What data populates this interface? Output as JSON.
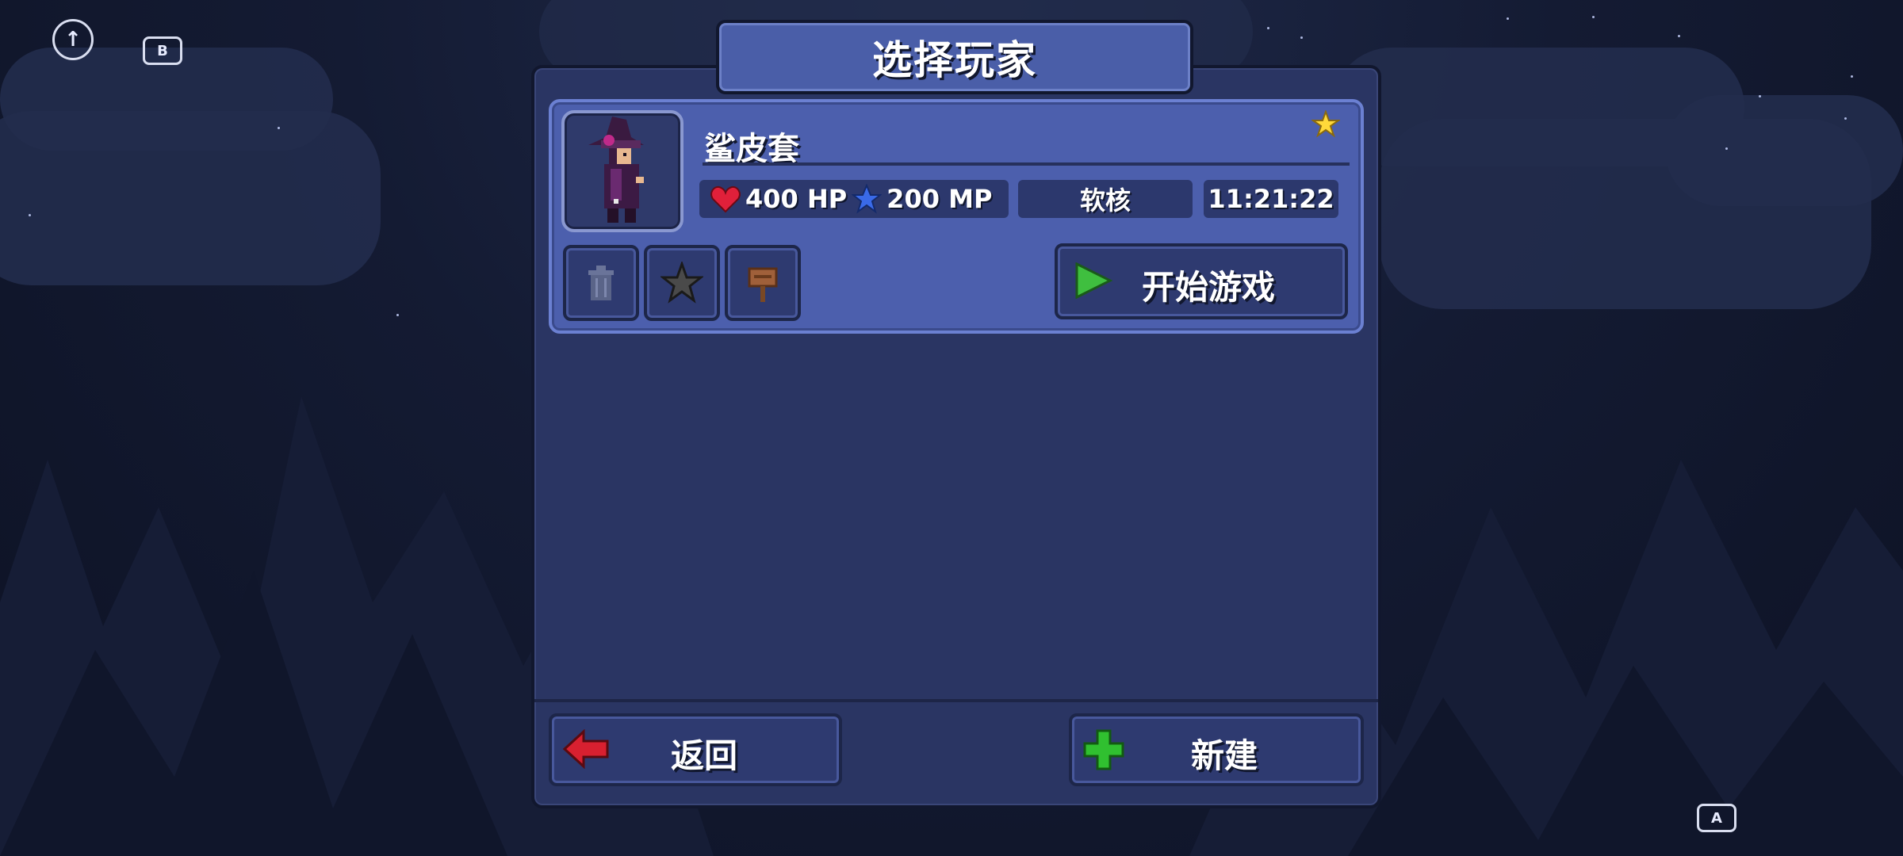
{
  "dialog": {
    "title": "选择玩家"
  },
  "player": {
    "name": "鲨皮套",
    "hp": "400 HP",
    "mp": "200 MP",
    "mode": "软核",
    "playtime": "11:21:22"
  },
  "actions": {
    "play_label": "开始游戏",
    "back_label": "返回",
    "new_label": "新建"
  },
  "corner_buttons": {
    "b": "B",
    "a": "A",
    "up": "↑"
  },
  "icons": {
    "delete": "trash-icon",
    "favorite": "star-icon",
    "rename": "sign-icon",
    "play": "play-arrow-icon",
    "back": "red-arrow-icon",
    "new": "green-plus-icon",
    "heart": "heart-icon",
    "mana": "mana-star-icon"
  },
  "colors": {
    "panel": "#2a3563",
    "title": "#4a5ea8",
    "card": "#4c5fad",
    "heart": "#e0203a",
    "mana": "#3a6ae8",
    "play": "#3fbf3f",
    "back_arrow": "#d82030",
    "plus": "#30c030"
  }
}
